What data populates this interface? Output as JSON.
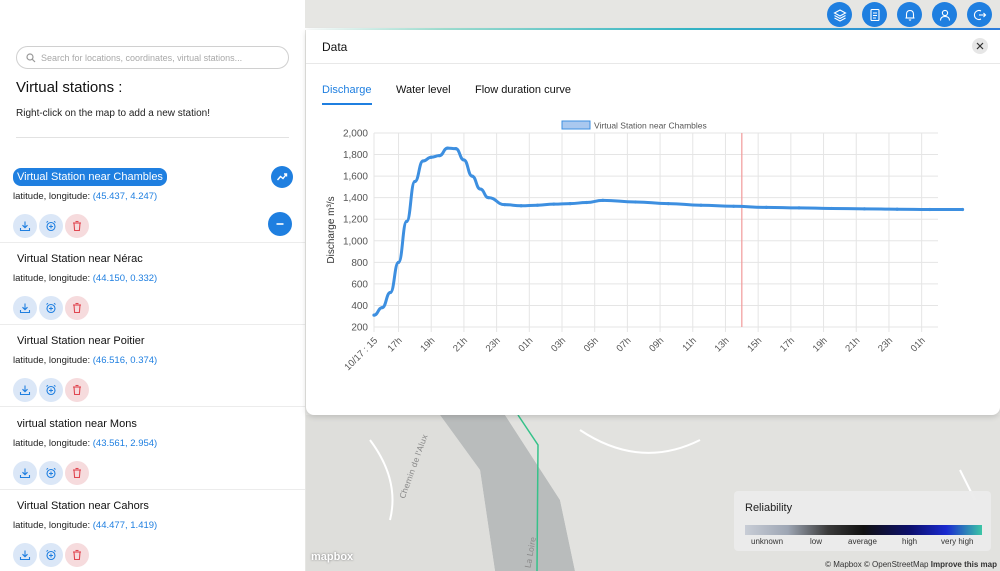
{
  "search": {
    "placeholder": "Search for locations, coordinates, virtual stations..."
  },
  "sidebar": {
    "title": "Virtual stations :",
    "hint": "Right-click on the map to add a new station!",
    "coords_label": "latitude, longitude:",
    "stations": [
      {
        "name": "Virtual Station near Chambles",
        "coords": "(45.437, 4.247)",
        "selected": true
      },
      {
        "name": "Virtual Station near Nérac",
        "coords": "(44.150, 0.332)",
        "selected": false
      },
      {
        "name": "Virtual Station near Poitier",
        "coords": "(46.516, 0.374)",
        "selected": false
      },
      {
        "name": "virtual station near Mons",
        "coords": "(43.561, 2.954)",
        "selected": false
      },
      {
        "name": "Virtual Station near Cahors",
        "coords": "(44.477, 1.419)",
        "selected": false
      }
    ]
  },
  "topbar": {
    "icons": [
      "layers-icon",
      "document-icon",
      "bell-icon",
      "user-icon",
      "logout-icon"
    ]
  },
  "panel": {
    "title": "Data",
    "tabs": [
      {
        "label": "Discharge",
        "active": true
      },
      {
        "label": "Water level",
        "active": false
      },
      {
        "label": "Flow duration curve",
        "active": false
      }
    ]
  },
  "chart_data": {
    "type": "line",
    "legend": "Virtual Station near Chambles",
    "ylabel": "Discharge m³/s",
    "xlabel": "",
    "ylim": [
      200,
      2000
    ],
    "yticks": [
      "200",
      "400",
      "600",
      "800",
      "1,000",
      "1,200",
      "1,400",
      "1,600",
      "1,800",
      "2,000"
    ],
    "xticks": [
      "10/17 : 15",
      "17h",
      "19h",
      "21h",
      "23h",
      "01h",
      "03h",
      "05h",
      "07h",
      "09h",
      "11h",
      "13h",
      "15h",
      "17h",
      "19h",
      "21h",
      "23h",
      "01h"
    ],
    "grid": true,
    "marker_line_at": "14h",
    "series": [
      {
        "name": "Virtual Station near Chambles",
        "color": "#3d8fe0",
        "x_hours": [
          0,
          0.5,
          1,
          1.5,
          2,
          2.5,
          3,
          3.5,
          4,
          4.5,
          5,
          5.5,
          6,
          6.5,
          7,
          8,
          9,
          10,
          11,
          12,
          13,
          14,
          16,
          18,
          20,
          22,
          24,
          26,
          28,
          30,
          32,
          34,
          36
        ],
        "values": [
          310,
          380,
          520,
          800,
          1180,
          1550,
          1740,
          1775,
          1790,
          1860,
          1855,
          1750,
          1600,
          1480,
          1400,
          1335,
          1325,
          1330,
          1340,
          1345,
          1355,
          1375,
          1360,
          1345,
          1330,
          1320,
          1310,
          1305,
          1300,
          1296,
          1293,
          1290,
          1290
        ]
      }
    ]
  },
  "reliability": {
    "title": "Reliability",
    "labels": [
      "unknown",
      "low",
      "average",
      "high",
      "very high"
    ]
  },
  "map": {
    "labels": [
      "Chemin de l'Alux",
      "La Loire"
    ],
    "logo": "mapbox",
    "attribution": "© Mapbox © OpenStreetMap",
    "improve": "Improve this map"
  }
}
